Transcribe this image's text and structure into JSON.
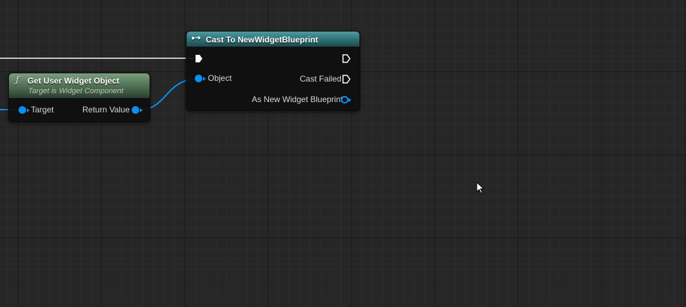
{
  "nodes": {
    "get_user_widget": {
      "title": "Get User Widget Object",
      "subtitle": "Target is Widget Component",
      "input_pin": "Target",
      "output_pin": "Return Value",
      "icon": "function-f-icon",
      "header_color": "#56775a"
    },
    "cast": {
      "title": "Cast To NewWidgetBlueprint",
      "icon": "cast-arrows-icon",
      "header_color": "#2f7378",
      "input_pin": "Object",
      "output_pins": [
        "Cast Failed",
        "As New Widget Blueprint"
      ]
    }
  },
  "colors": {
    "graph_background": "#262626",
    "object_pin": "#0e8ff0",
    "exec_wire": "#cfcfcf"
  },
  "cursor": "mouse-pointer-icon"
}
